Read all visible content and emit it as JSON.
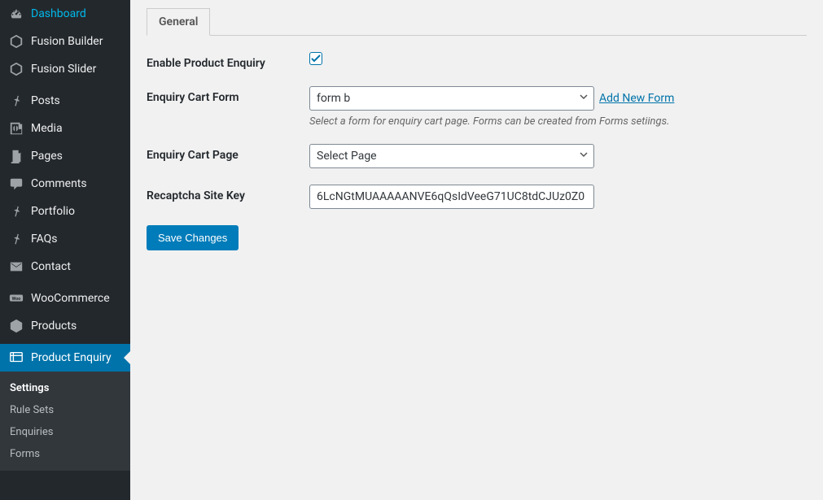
{
  "sidebar": {
    "groups": [
      [
        {
          "icon": "dashboard",
          "label": "Dashboard"
        },
        {
          "icon": "fusion",
          "label": "Fusion Builder"
        },
        {
          "icon": "fusion",
          "label": "Fusion Slider"
        }
      ],
      [
        {
          "icon": "pin",
          "label": "Posts"
        },
        {
          "icon": "media",
          "label": "Media"
        },
        {
          "icon": "pages",
          "label": "Pages"
        },
        {
          "icon": "comment",
          "label": "Comments"
        },
        {
          "icon": "pin",
          "label": "Portfolio"
        },
        {
          "icon": "pin",
          "label": "FAQs"
        },
        {
          "icon": "mail",
          "label": "Contact"
        }
      ],
      [
        {
          "icon": "woo",
          "label": "WooCommerce"
        },
        {
          "icon": "products",
          "label": "Products"
        }
      ],
      [
        {
          "icon": "enquiry",
          "label": "Product Enquiry",
          "current": true
        }
      ]
    ],
    "submenu": [
      {
        "label": "Settings",
        "active": true
      },
      {
        "label": "Rule Sets"
      },
      {
        "label": "Enquiries"
      },
      {
        "label": "Forms"
      }
    ]
  },
  "tabs": [
    {
      "label": "General"
    }
  ],
  "form": {
    "enable": {
      "label": "Enable Product Enquiry",
      "checked": true
    },
    "cart_form": {
      "label": "Enquiry Cart Form",
      "value": "form b",
      "add_link": "Add New Form",
      "description": "Select a form for enquiry cart page. Forms can be created from Forms setiings."
    },
    "cart_page": {
      "label": "Enquiry Cart Page",
      "value": "Select Page"
    },
    "recaptcha": {
      "label": "Recaptcha Site Key",
      "value": "6LcNGtMUAAAAANVE6qQsIdVeeG71UC8tdCJUz0Z0"
    },
    "save_button": "Save Changes"
  }
}
